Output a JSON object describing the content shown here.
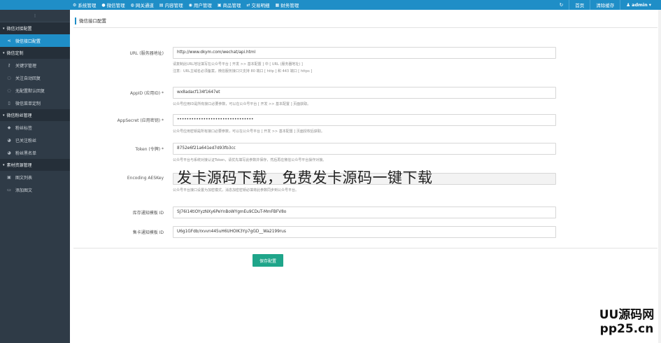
{
  "topnav": {
    "items": [
      {
        "icon": "gear-icon",
        "glyph": "⚙",
        "label": "系统管理"
      },
      {
        "icon": "wechat-icon",
        "glyph": "●",
        "label": "微信管理"
      },
      {
        "icon": "globe-icon",
        "glyph": "◍",
        "label": "网关通道"
      },
      {
        "icon": "document-icon",
        "glyph": "▤",
        "label": "内容管理"
      },
      {
        "icon": "user-icon",
        "glyph": "◉",
        "label": "用户管理"
      },
      {
        "icon": "shop-icon",
        "glyph": "▣",
        "label": "商品管理"
      },
      {
        "icon": "exchange-icon",
        "glyph": "⇄",
        "label": "交易明细"
      },
      {
        "icon": "finance-icon",
        "glyph": "▦",
        "label": "财务管理"
      }
    ],
    "refresh_glyph": "↻",
    "home_label": "首页",
    "clear_cache_label": "清除缓存",
    "user_label": "admin",
    "user_glyph": "♟",
    "user_caret": "▾"
  },
  "sidebar": {
    "toggle_glyph": "⁝",
    "groups": [
      {
        "label": "微信对接配置",
        "items": [
          {
            "icon": "share-icon",
            "glyph": "⋖",
            "label": "微信接口配置",
            "active": true
          }
        ]
      },
      {
        "label": "微信定制",
        "items": [
          {
            "icon": "key-icon",
            "glyph": "⚷",
            "label": "关键字管理"
          },
          {
            "icon": "comment-icon",
            "glyph": "◌",
            "label": "关注自动回复"
          },
          {
            "icon": "comment-icon",
            "glyph": "◌",
            "label": "无配置默认回复"
          },
          {
            "icon": "mobile-icon",
            "glyph": "▯",
            "label": "微信菜单定制"
          }
        ]
      },
      {
        "label": "微信粉丝管理",
        "items": [
          {
            "icon": "tag-icon",
            "glyph": "◆",
            "label": "粉丝标签"
          },
          {
            "icon": "users-icon",
            "glyph": "◕",
            "label": "已关注粉丝"
          },
          {
            "icon": "users-icon",
            "glyph": "◕",
            "label": "粉丝黑名单"
          }
        ]
      },
      {
        "label": "素材资源管理",
        "items": [
          {
            "icon": "image-icon",
            "glyph": "▣",
            "label": "图文列表"
          },
          {
            "icon": "folder-icon",
            "glyph": "▭",
            "label": "添加图文"
          }
        ]
      }
    ],
    "caret": "▾"
  },
  "page": {
    "breadcrumb": "微信接口配置",
    "form": [
      {
        "label": "URL (服务器地址)",
        "value": "http://www.dkym.com/wechat/api.html",
        "help": [
          "请复制此URL地址填写在公众号平台 [ 开发 >> 基本配置 ] 中 [ URL (服务器地址) ]",
          "注意：URL主域名必须备案，微信服务接口只支持 80 端口 [ http ] 和 443 端口 [ https ]"
        ]
      },
      {
        "label": "AppID (应用ID) *",
        "value": "wx8adacf134f1647et",
        "help": [
          "公众号应用ID是所有接口必要参数，可以在公众号平台 [ 开发 >> 基本配置 ] 页面获取。"
        ]
      },
      {
        "label": "AppSecret (应用密钥) *",
        "value": "••••••••••••••••••••••••••••••••",
        "help": [
          "公众号应用密钥是所有接口必要参数，可以在公众号平台 [ 开发 >> 基本配置 ] 页面授权后获取。"
        ]
      },
      {
        "label": "Token (令牌) *",
        "value": "8752e6f21a641ed7d93fb3cc",
        "help": [
          "公众号平台与系统对接认证Token，请优先填写此参数并保存，然后再在微信公众号平台操作对接。"
        ]
      },
      {
        "label": "Encoding AESKey",
        "value": "",
        "help": [
          "公众号平台接口设置为加密模式，消息加密密钥必填将此参数同步到公众号平台。"
        ]
      },
      {
        "label": "库存通知模板 ID",
        "value": "SJ76l14tiOYyzNXy6PeYnBoWYgmEu9CDuT-MmFBFV8o",
        "help": []
      },
      {
        "label": "售卡通知模板 ID",
        "value": "U6g1GFdb/rxvvn445uH6UHOIK3Yp7gGD__Wa2199rus",
        "help": []
      }
    ],
    "save_label": "保存配置"
  },
  "watermark": {
    "caption": "发卡源码下载，免费发卡源码一键下载",
    "logo_line1": "UU源码网",
    "logo_line2": "pp25.cn"
  }
}
